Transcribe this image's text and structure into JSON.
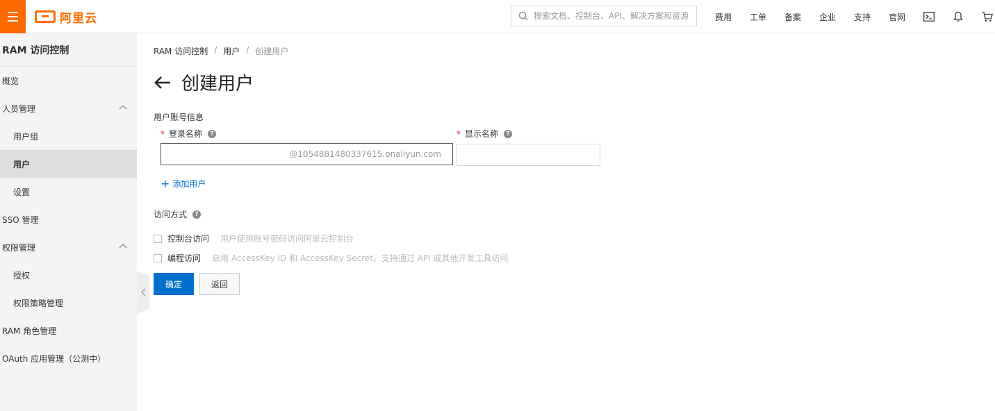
{
  "header": {
    "logo_text": "阿里云",
    "search_placeholder": "搜索文档、控制台、API、解决方案和资源",
    "nav_items": [
      "费用",
      "工单",
      "备案",
      "企业",
      "支持",
      "官网"
    ],
    "accent_color": "#ff6a00"
  },
  "sidebar": {
    "title": "RAM 访问控制",
    "items": [
      {
        "label": "概览"
      },
      {
        "label": "人员管理"
      },
      {
        "label": "用户组"
      },
      {
        "label": "用户"
      },
      {
        "label": "设置"
      },
      {
        "label": "SSO 管理"
      },
      {
        "label": "权限管理"
      },
      {
        "label": "授权"
      },
      {
        "label": "权限策略管理"
      },
      {
        "label": "RAM 角色管理"
      },
      {
        "label": "OAuth 应用管理（公测中）"
      }
    ]
  },
  "breadcrumb": {
    "items": [
      "RAM 访问控制",
      "用户",
      "创建用户"
    ],
    "separator": "/"
  },
  "page": {
    "title": "创建用户",
    "account_section": "用户账号信息",
    "login_name_label": "登录名称",
    "login_name_value": "",
    "login_suffix": "@1054881480337615.onaliyun.com",
    "display_name_label": "显示名称",
    "display_name_value": "",
    "required_mark": "*",
    "add_user": "添加用户",
    "access_section": "访问方式",
    "console_access_label": "控制台访问",
    "console_access_desc": "用户使用账号密码访问阿里云控制台",
    "programmatic_access_label": "编程访问",
    "programmatic_access_desc": "启用 AccessKey ID 和 AccessKey Secret，支持通过 API 或其他开发工具访问",
    "confirm_button": "确定",
    "back_button": "返回",
    "primary_color": "#0070cc"
  }
}
